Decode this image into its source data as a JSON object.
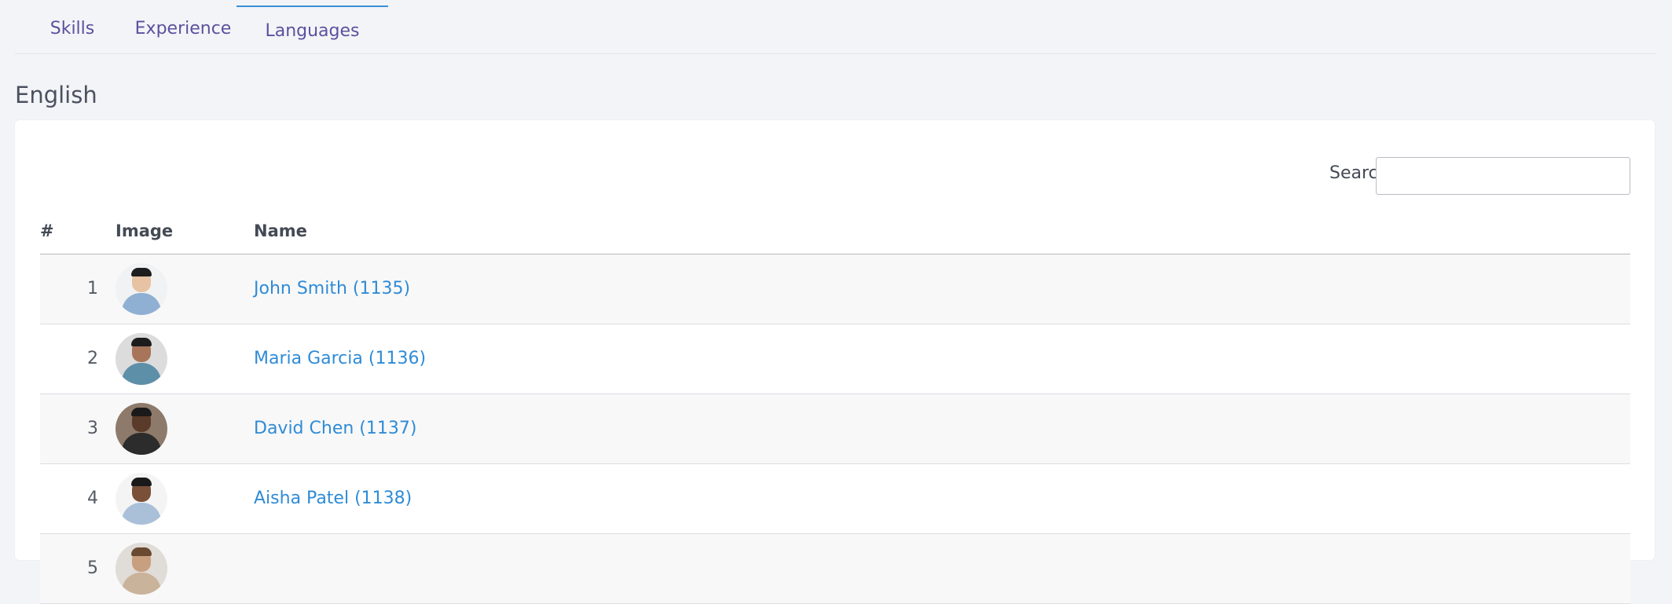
{
  "tabs": [
    {
      "label": "Skills",
      "active": false
    },
    {
      "label": "Experience",
      "active": false
    },
    {
      "label": "Languages",
      "active": true
    }
  ],
  "section": {
    "title": "English"
  },
  "search": {
    "label": "Search:",
    "value": "",
    "placeholder": ""
  },
  "table": {
    "headers": {
      "num": "#",
      "image": "Image",
      "name": "Name"
    },
    "rows": [
      {
        "num": "1",
        "name": "John Smith (1135)",
        "avatar": {
          "bg": "#f1f2f4",
          "skin": "#e7c3a3",
          "hair": "#1e1e1e",
          "shirt": "#8fb0d2"
        }
      },
      {
        "num": "2",
        "name": "Maria Garcia (1136)",
        "avatar": {
          "bg": "#dcdcdc",
          "skin": "#a8755a",
          "hair": "#1c1c1c",
          "shirt": "#5e8fa8"
        }
      },
      {
        "num": "3",
        "name": "David Chen (1137)",
        "avatar": {
          "bg": "#8d7a6a",
          "skin": "#5a3a28",
          "hair": "#1a1a1a",
          "shirt": "#2c2c2c"
        }
      },
      {
        "num": "4",
        "name": "Aisha Patel (1138)",
        "avatar": {
          "bg": "#f4f4f4",
          "skin": "#7a5038",
          "hair": "#1a1a1a",
          "shirt": "#a9c0d8"
        }
      },
      {
        "num": "5",
        "name": "",
        "avatar": {
          "bg": "#e0dcd8",
          "skin": "#c8a080",
          "hair": "#6a4a30",
          "shirt": "#c9b39a"
        }
      }
    ]
  }
}
